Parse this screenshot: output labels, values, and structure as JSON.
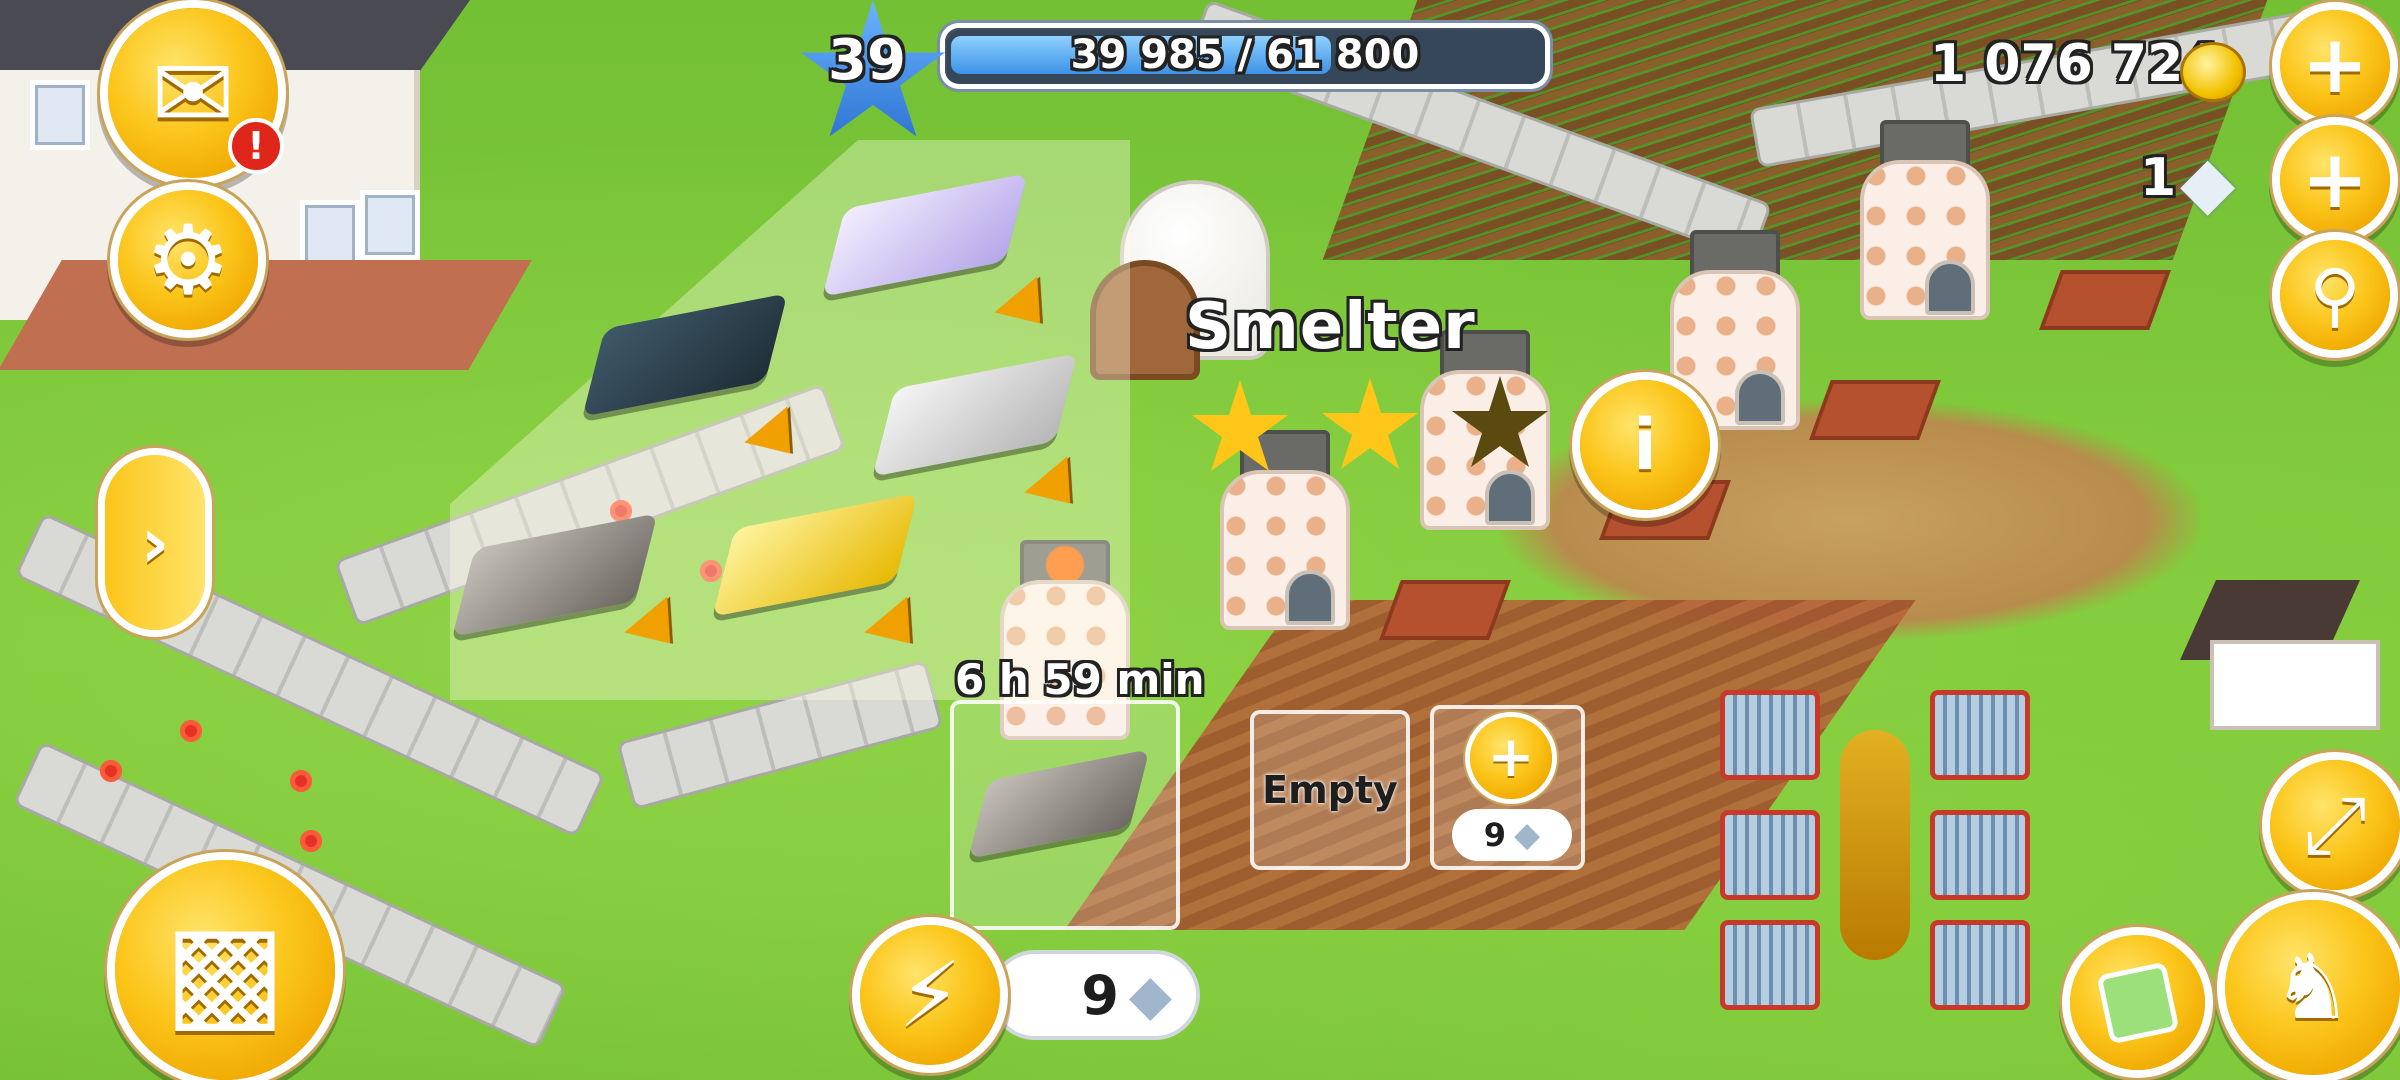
{
  "hud": {
    "level": "39",
    "xp_text": "39 985 / 61 800",
    "xp_progress_fraction": 0.647,
    "coins": "1 076 724",
    "diamonds": "1"
  },
  "building": {
    "name": "Smelter",
    "stars_filled": 2,
    "stars_total": 3,
    "timer": "6 h 59 min",
    "empty_slot_label": "Empty",
    "unlock_slot_cost": "9",
    "finish_cost": "9"
  },
  "icons": {
    "mail": "mail-icon",
    "alert": "alert-icon",
    "settings": "gear-icon",
    "expand": "chevron-right-icon",
    "shop": "cash-register-icon",
    "speed": "lightning-icon",
    "diamond": "diamond-icon",
    "coin": "coin-icon",
    "add": "plus-icon",
    "search": "magnifier-icon",
    "info": "info-icon",
    "zoom": "expand-icon",
    "friends": "friends-icon",
    "map": "map-card-icon"
  },
  "colors": {
    "gold": "#fbc51a",
    "xp_bar": "#4aa3ee",
    "star_filled": "#ffc61a",
    "star_empty": "#5a4a10"
  }
}
